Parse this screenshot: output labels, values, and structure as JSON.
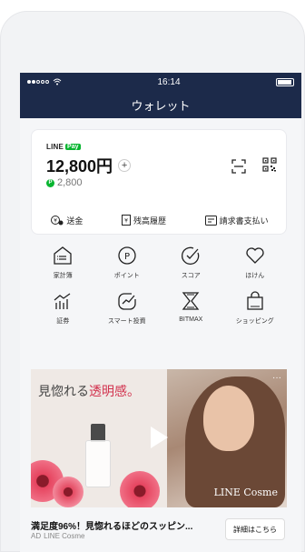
{
  "status_bar": {
    "carrier": "●●○○○",
    "time": "16:14"
  },
  "nav": {
    "title": "ウォレット"
  },
  "balance": {
    "brand_line": "LINE",
    "brand_pay": "Pay",
    "amount": "12,800円",
    "add_label": "+",
    "points": "2,800",
    "point_symbol": "P"
  },
  "actions": [
    {
      "label": "送金",
      "icon": "send-money-icon"
    },
    {
      "label": "残高履歴",
      "icon": "history-icon"
    },
    {
      "label": "請求書支払い",
      "icon": "bill-icon"
    }
  ],
  "services": [
    {
      "label": "家計簿",
      "icon": "household-account-icon"
    },
    {
      "label": "ポイント",
      "icon": "point-icon"
    },
    {
      "label": "スコア",
      "icon": "score-icon"
    },
    {
      "label": "ほけん",
      "icon": "heart-icon"
    },
    {
      "label": "証券",
      "icon": "securities-icon"
    },
    {
      "label": "スマート投資",
      "icon": "smart-invest-icon"
    },
    {
      "label": "BITMAX",
      "icon": "bitmax-icon"
    },
    {
      "label": "ショッピング",
      "icon": "shopping-icon"
    }
  ],
  "ad": {
    "headline_prefix": "見惚れる",
    "headline_accent": "透明感。",
    "overlay_brand": "LINE Cosme",
    "more": "···",
    "title": "満足度96%！見惚れるほどのスッピン...",
    "tag": "AD",
    "sponsor": "LINE Cosme",
    "cta": "詳細はこちら"
  },
  "colors": {
    "header": "#1c2a4a",
    "line_green": "#08b530",
    "ad_accent": "#d2324e"
  }
}
